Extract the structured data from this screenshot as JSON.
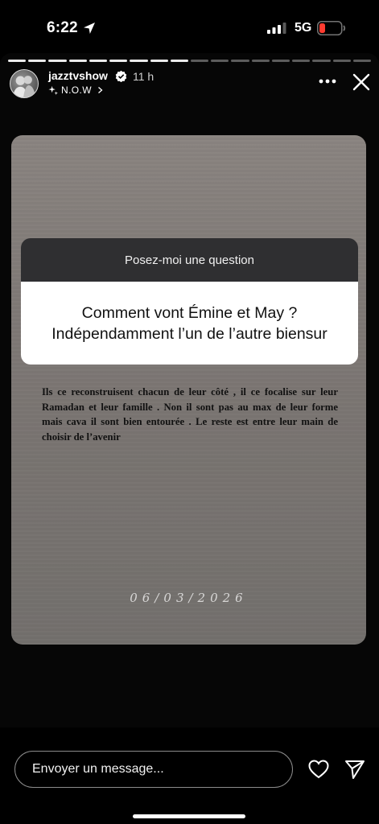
{
  "status_bar": {
    "time": "6:22",
    "network": "5G",
    "battery_color": "#ff3b30",
    "icons": [
      "location-arrow-icon",
      "signal-bars-icon",
      "battery-icon"
    ]
  },
  "story": {
    "progress": {
      "segments_total": 18,
      "segments_viewed": 9
    },
    "user": {
      "username": "jazztvshow",
      "verified": true,
      "posted_ago": "11 h"
    },
    "music_label": "N.O.W",
    "question_box": {
      "header": "Posez-moi une question",
      "question_line1": "Comment vont Émine et May ?",
      "question_line2": "Indépendamment l’un de l’autre biensur"
    },
    "answer": "Ils ce reconstruisent chacun de leur côté , il ce focalise sur leur Ramadan et leur famille . Non il sont pas au max de leur forme mais cava il sont bien entourée . Le reste est entre leur main de choisir de l’avenir",
    "date": "06/03/2026"
  },
  "bottom_bar": {
    "message_placeholder": "Envoyer un message..."
  }
}
